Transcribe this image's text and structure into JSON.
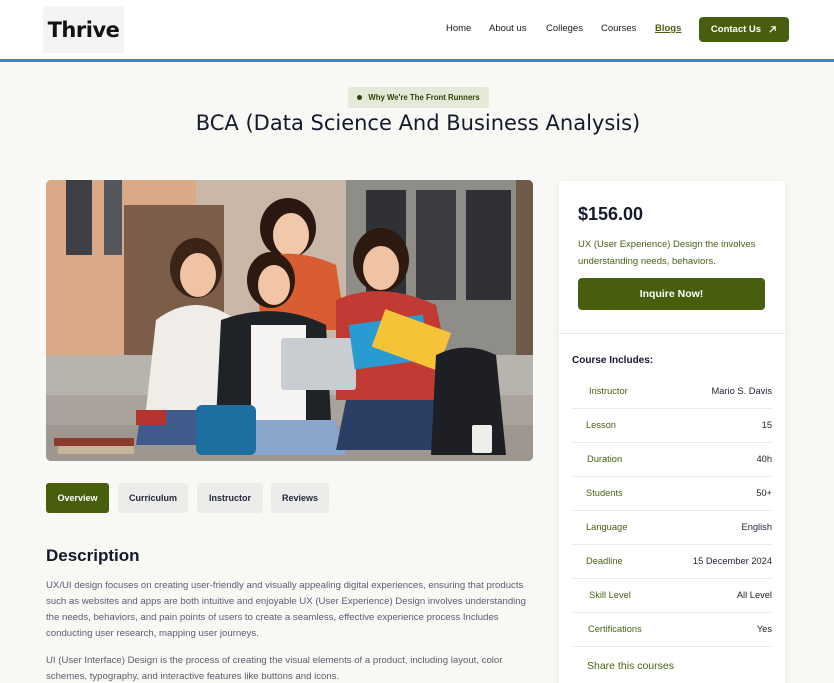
{
  "header": {
    "logo": "Thrive",
    "nav": [
      "Home",
      "About us",
      "Colleges",
      "Courses",
      "Blogs"
    ],
    "active_nav": "Blogs",
    "contact_label": "Contact Us"
  },
  "hero": {
    "eyebrow": "Why We're The Front Runners",
    "title": "BCA (Data Science And Business Analysis)"
  },
  "tabs": [
    "Overview",
    "Curriculum",
    "Instructor",
    "Reviews"
  ],
  "description": {
    "title": "Description",
    "paragraphs": [
      "UX/UI design focuses on creating user-friendly and visually appealing digital experiences, ensuring that products such as websites and apps are both intuitive and enjoyable UX (User Experience) Design involves understanding the needs, behaviors, and pain points of users to create a seamless, effective experience process Includes conducting user research, mapping user journeys.",
      "UI (User Interface) Design is the process of creating the visual elements of a product, including layout, color schemes, typography, and interactive features like buttons and icons."
    ]
  },
  "sidebar": {
    "price": "$156.00",
    "description": "UX (User Experience) Design the involves understanding needs, behaviors.",
    "inquire_label": "Inquire Now!",
    "includes_title": "Course Includes:",
    "rows": [
      {
        "label": "Instructor",
        "value": "Mario S. Davis"
      },
      {
        "label": "Lesson",
        "value": "15"
      },
      {
        "label": "Duration",
        "value": "40h"
      },
      {
        "label": "Students",
        "value": "50+"
      },
      {
        "label": "Language",
        "value": "English"
      },
      {
        "label": "Deadline",
        "value": "15 December 2024"
      },
      {
        "label": "Skill Level",
        "value": "All Level"
      },
      {
        "label": "Certifications",
        "value": "Yes"
      }
    ],
    "share_label": "Share this courses"
  },
  "colors": {
    "brand_green": "#475f0d",
    "accent_blue": "#2f87d8",
    "label_green": "#4a6112"
  }
}
